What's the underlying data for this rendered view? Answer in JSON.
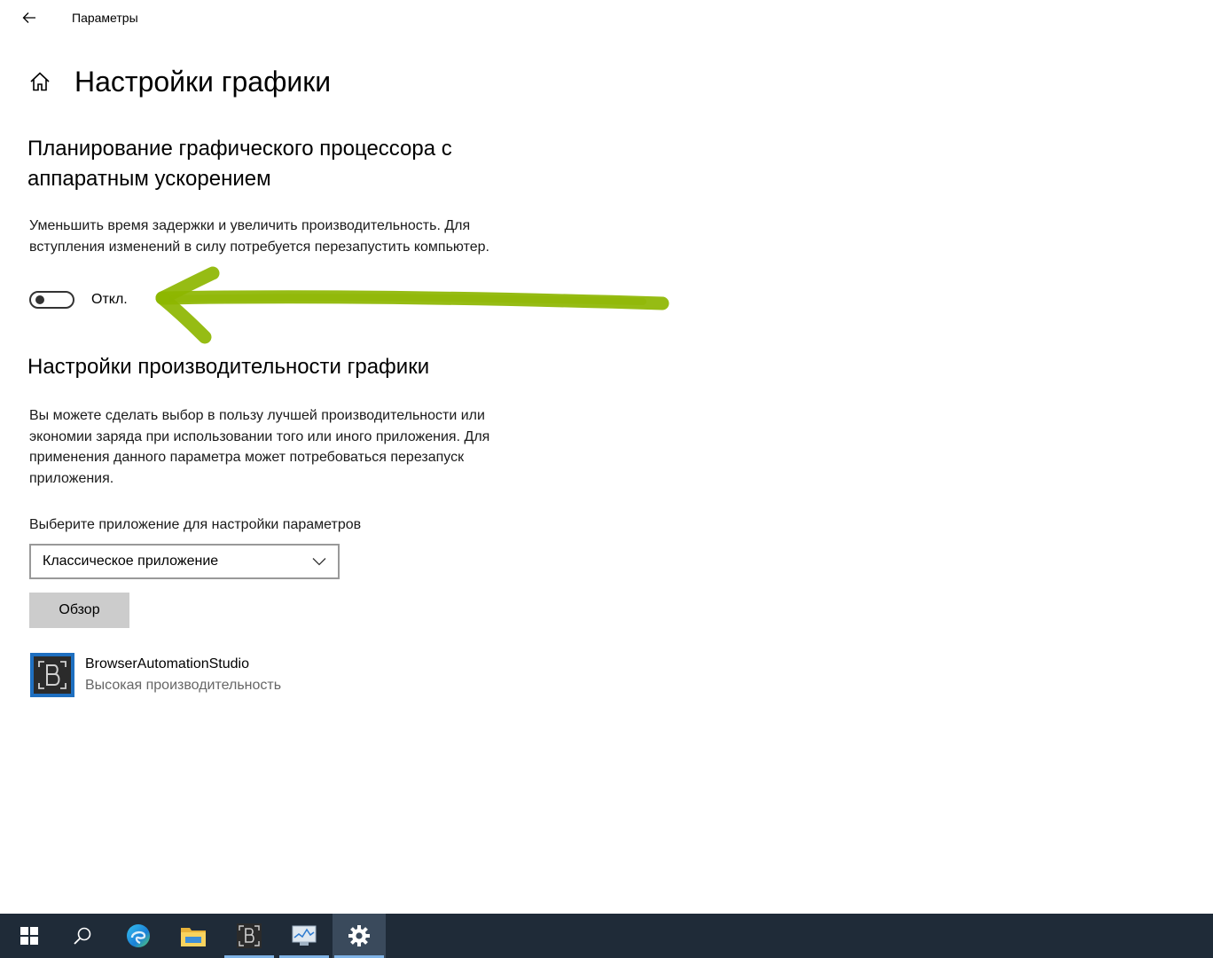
{
  "window": {
    "title": "Параметры"
  },
  "page": {
    "title": "Настройки графики"
  },
  "gpu_scheduling": {
    "title": "Планирование графического процессора с аппаратным ускорением",
    "description": "Уменьшить время задержки и увеличить производительность. Для вступления изменений в силу потребуется перезапустить компьютер.",
    "toggle_state": "Откл.",
    "toggle_on": false
  },
  "performance": {
    "title": "Настройки производительности графики",
    "description": "Вы можете сделать выбор в пользу лучшей производительности или экономии заряда при использовании того или иного приложения. Для применения данного параметра может потребоваться перезапуск приложения.",
    "select_label": "Выберите приложение для настройки параметров",
    "select_value": "Классическое приложение",
    "browse_label": "Обзор",
    "apps": [
      {
        "name": "BrowserAutomationStudio",
        "status": "Высокая производительность"
      }
    ]
  },
  "annotation": {
    "arrow_color": "#8db600"
  },
  "taskbar": {
    "items": [
      {
        "icon": "windows-start-icon"
      },
      {
        "icon": "search-icon"
      },
      {
        "icon": "edge-icon"
      },
      {
        "icon": "file-explorer-icon"
      },
      {
        "icon": "browser-automation-studio-icon"
      },
      {
        "icon": "task-manager-icon"
      },
      {
        "icon": "settings-gear-icon"
      }
    ]
  }
}
